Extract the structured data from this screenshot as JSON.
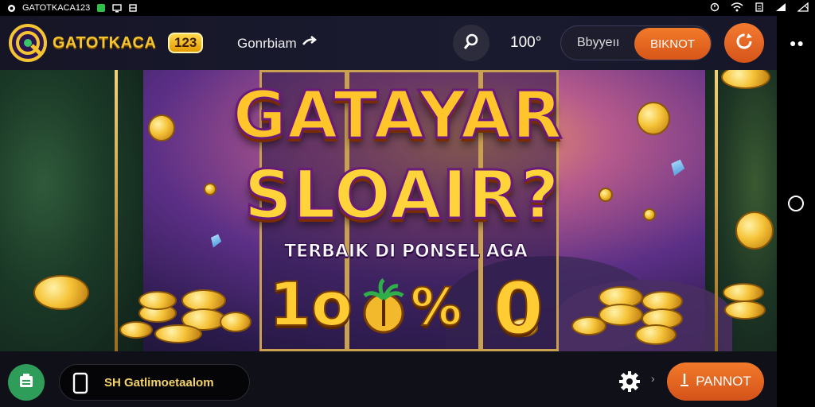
{
  "status_bar": {
    "app_label": "GATOTKACA123",
    "icons": [
      "circle-app-icon",
      "chat-icon",
      "screen-icon",
      "game-icon"
    ],
    "right_icons": [
      "alarm-icon",
      "wifi-icon",
      "battery-saver-icon",
      "signal-icon",
      "battery-icon"
    ]
  },
  "header": {
    "brand": "GATOTKACA",
    "brand_number": "123",
    "link_label": "Gonrbiam",
    "balance": "100°",
    "secondary_action": "Bbyyeıı",
    "primary_action": "BIKNOT"
  },
  "banner": {
    "line1": "GATAYAR",
    "line2": "SLOAIR?",
    "subtitle": "TERBAIK DI PONSEL AGA",
    "symbols": [
      "1o",
      "%",
      "0"
    ]
  },
  "bottom_bar": {
    "download_label": "SH Gatlimoetaalom",
    "cta_label": "PANNOT",
    "arrow": "›"
  },
  "colors": {
    "accent_orange": "#e8641f",
    "gold": "#f5c431",
    "wallet_green": "#2f9d5a"
  }
}
